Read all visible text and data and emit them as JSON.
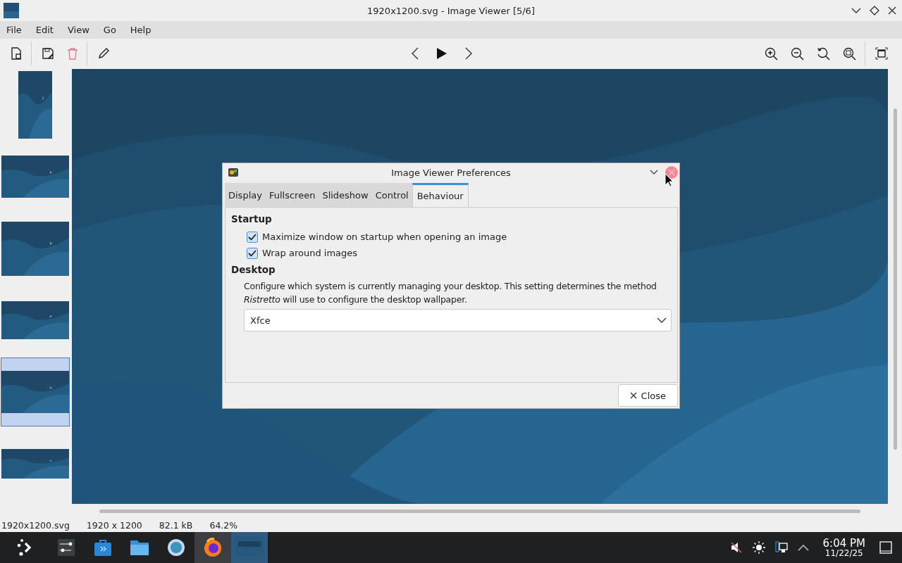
{
  "window": {
    "title": "1920x1200.svg - Image Viewer [5/6]"
  },
  "menu": [
    "File",
    "Edit",
    "View",
    "Go",
    "Help"
  ],
  "thumbnails": [
    {
      "kind": "portrait",
      "selected": false
    },
    {
      "kind": "landscape",
      "selected": false
    },
    {
      "kind": "landscape",
      "selected": false
    },
    {
      "kind": "landscape",
      "selected": false
    },
    {
      "kind": "landscape",
      "selected": true
    },
    {
      "kind": "landscape",
      "selected": false
    }
  ],
  "dialog": {
    "title": "Image Viewer Preferences",
    "tabs": [
      {
        "label": "Display",
        "selected": false
      },
      {
        "label": "Fullscreen",
        "selected": false
      },
      {
        "label": "Slideshow",
        "selected": false
      },
      {
        "label": "Control",
        "selected": false
      },
      {
        "label": "Behaviour",
        "selected": true
      }
    ],
    "startup_heading": "Startup",
    "checkboxes": [
      {
        "label": "Maximize window on startup when opening an image",
        "checked": true
      },
      {
        "label": "Wrap around images",
        "checked": true
      }
    ],
    "desktop_heading": "Desktop",
    "description": "Configure which system is currently managing your desktop. This setting determines the method *Ristretto* will use to configure the desktop wallpaper.",
    "dropdown": {
      "value": "Xfce"
    },
    "close_button": "Close"
  },
  "status_bar": [
    "1920x1200.svg",
    "1920 x 1200",
    "82.1 kB",
    "64.2%"
  ],
  "taskbar": [
    {
      "running": false,
      "selected": false
    },
    {
      "running": false,
      "selected": false
    },
    {
      "running": false,
      "selected": false
    },
    {
      "running": false,
      "selected": false
    },
    {
      "running": true,
      "selected": false
    },
    {
      "running": true,
      "selected": true
    }
  ],
  "clock": {
    "time": "6:04 PM",
    "date": "11/22/25"
  }
}
